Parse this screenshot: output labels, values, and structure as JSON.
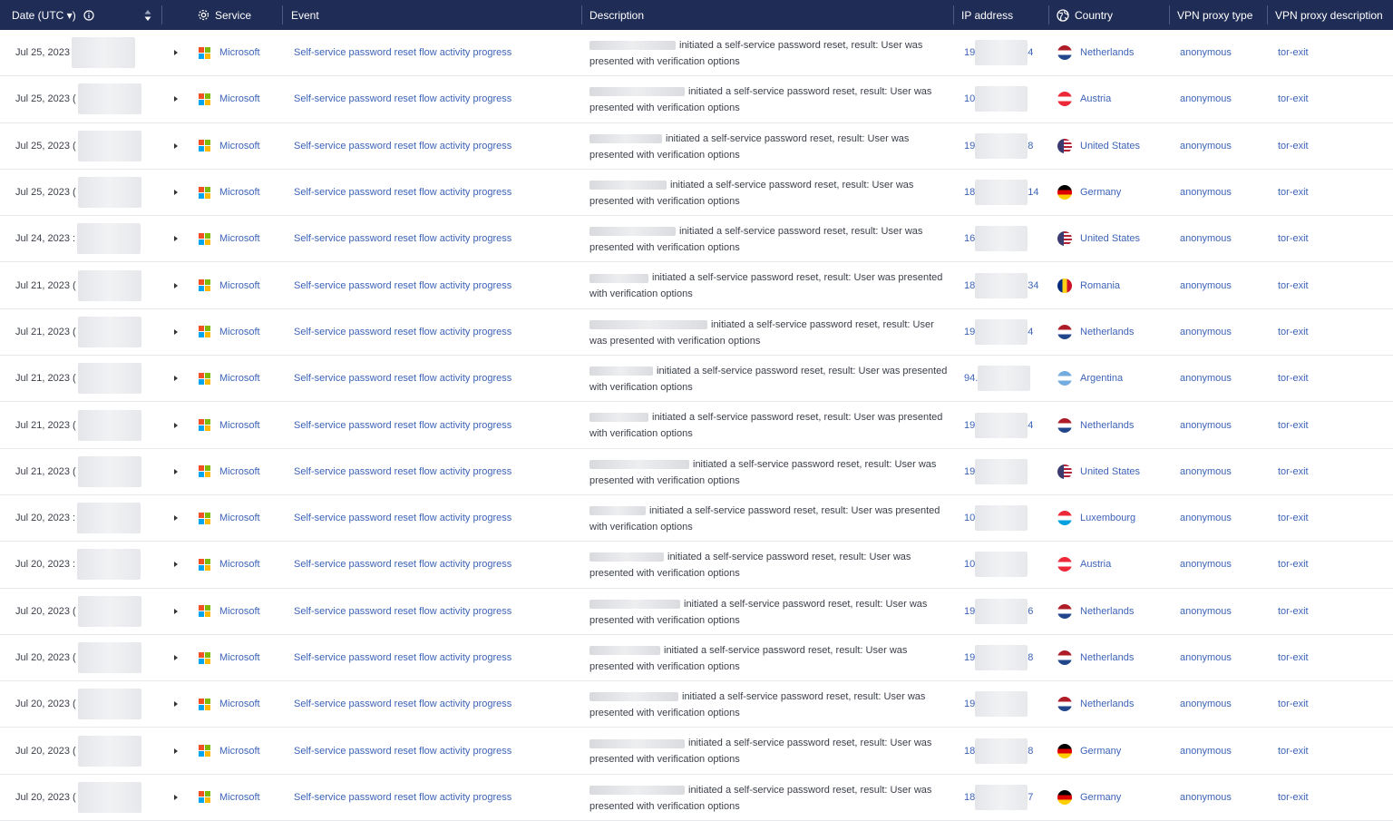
{
  "header": {
    "date": "Date (UTC ▾)",
    "service": "Service",
    "event": "Event",
    "description": "Description",
    "ip": "IP address",
    "country": "Country",
    "vpn_type": "VPN proxy type",
    "vpn_desc": "VPN proxy description"
  },
  "colors": {
    "header_bg": "#1f2c55",
    "link": "#3d63b8"
  },
  "description_text": "initiated a self-service password reset, result: User was presented with verification options",
  "rows": [
    {
      "date": "Jul 25, 2023",
      "service": "Microsoft",
      "event": "Self-service password reset flow activity progress",
      "ip_start": "19",
      "ip_end": "4",
      "country": "Netherlands",
      "flag": "nl",
      "vpn_type": "anonymous",
      "vpn_desc": "tor-exit"
    },
    {
      "date": "Jul 25, 2023 (",
      "service": "Microsoft",
      "event": "Self-service password reset flow activity progress",
      "ip_start": "10",
      "ip_end": "",
      "country": "Austria",
      "flag": "at",
      "vpn_type": "anonymous",
      "vpn_desc": "tor-exit"
    },
    {
      "date": "Jul 25, 2023 (",
      "service": "Microsoft",
      "event": "Self-service password reset flow activity progress",
      "ip_start": "19",
      "ip_end": "8",
      "country": "United States",
      "flag": "us",
      "vpn_type": "anonymous",
      "vpn_desc": "tor-exit"
    },
    {
      "date": "Jul 25, 2023 (",
      "service": "Microsoft",
      "event": "Self-service password reset flow activity progress",
      "ip_start": "18",
      "ip_end": "14",
      "country": "Germany",
      "flag": "de",
      "vpn_type": "anonymous",
      "vpn_desc": "tor-exit"
    },
    {
      "date": "Jul 24, 2023 :",
      "service": "Microsoft",
      "event": "Self-service password reset flow activity progress",
      "ip_start": "16",
      "ip_end": "",
      "country": "United States",
      "flag": "us",
      "vpn_type": "anonymous",
      "vpn_desc": "tor-exit"
    },
    {
      "date": "Jul 21, 2023 (",
      "service": "Microsoft",
      "event": "Self-service password reset flow activity progress",
      "ip_start": "18",
      "ip_end": "34",
      "country": "Romania",
      "flag": "ro",
      "vpn_type": "anonymous",
      "vpn_desc": "tor-exit"
    },
    {
      "date": "Jul 21, 2023 (",
      "service": "Microsoft",
      "event": "Self-service password reset flow activity progress",
      "ip_start": "19",
      "ip_end": "4",
      "country": "Netherlands",
      "flag": "nl",
      "vpn_type": "anonymous",
      "vpn_desc": "tor-exit"
    },
    {
      "date": "Jul 21, 2023 (",
      "service": "Microsoft",
      "event": "Self-service password reset flow activity progress",
      "ip_start": "94.",
      "ip_end": "",
      "country": "Argentina",
      "flag": "ar",
      "vpn_type": "anonymous",
      "vpn_desc": "tor-exit"
    },
    {
      "date": "Jul 21, 2023 (",
      "service": "Microsoft",
      "event": "Self-service password reset flow activity progress",
      "ip_start": "19",
      "ip_end": "4",
      "country": "Netherlands",
      "flag": "nl",
      "vpn_type": "anonymous",
      "vpn_desc": "tor-exit"
    },
    {
      "date": "Jul 21, 2023 (",
      "service": "Microsoft",
      "event": "Self-service password reset flow activity progress",
      "ip_start": "19",
      "ip_end": "",
      "country": "United States",
      "flag": "us",
      "vpn_type": "anonymous",
      "vpn_desc": "tor-exit"
    },
    {
      "date": "Jul 20, 2023 :",
      "service": "Microsoft",
      "event": "Self-service password reset flow activity progress",
      "ip_start": "10",
      "ip_end": "",
      "country": "Luxembourg",
      "flag": "lu",
      "vpn_type": "anonymous",
      "vpn_desc": "tor-exit"
    },
    {
      "date": "Jul 20, 2023 :",
      "service": "Microsoft",
      "event": "Self-service password reset flow activity progress",
      "ip_start": "10",
      "ip_end": "",
      "country": "Austria",
      "flag": "at",
      "vpn_type": "anonymous",
      "vpn_desc": "tor-exit"
    },
    {
      "date": "Jul 20, 2023 (",
      "service": "Microsoft",
      "event": "Self-service password reset flow activity progress",
      "ip_start": "19",
      "ip_end": "6",
      "country": "Netherlands",
      "flag": "nl",
      "vpn_type": "anonymous",
      "vpn_desc": "tor-exit"
    },
    {
      "date": "Jul 20, 2023 (",
      "service": "Microsoft",
      "event": "Self-service password reset flow activity progress",
      "ip_start": "19",
      "ip_end": "8",
      "country": "Netherlands",
      "flag": "nl",
      "vpn_type": "anonymous",
      "vpn_desc": "tor-exit"
    },
    {
      "date": "Jul 20, 2023 (",
      "service": "Microsoft",
      "event": "Self-service password reset flow activity progress",
      "ip_start": "19",
      "ip_end": "",
      "country": "Netherlands",
      "flag": "nl",
      "vpn_type": "anonymous",
      "vpn_desc": "tor-exit"
    },
    {
      "date": "Jul 20, 2023 (",
      "service": "Microsoft",
      "event": "Self-service password reset flow activity progress",
      "ip_start": "18",
      "ip_end": "8",
      "country": "Germany",
      "flag": "de",
      "vpn_type": "anonymous",
      "vpn_desc": "tor-exit"
    },
    {
      "date": "Jul 20, 2023 (",
      "service": "Microsoft",
      "event": "Self-service password reset flow activity progress",
      "ip_start": "18",
      "ip_end": "7",
      "country": "Germany",
      "flag": "de",
      "vpn_type": "anonymous",
      "vpn_desc": "tor-exit"
    }
  ]
}
